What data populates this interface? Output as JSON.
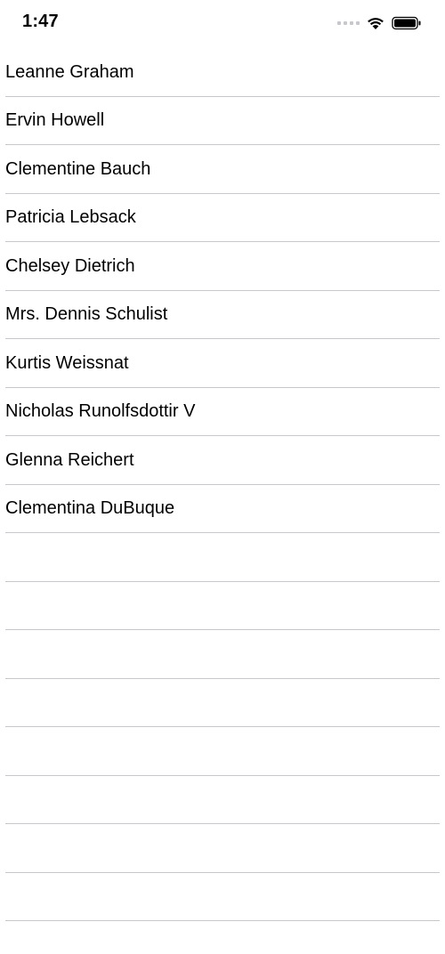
{
  "status_bar": {
    "time": "1:47",
    "icons": [
      "cellular-signal-icon",
      "wifi-icon",
      "battery-icon"
    ]
  },
  "users": [
    {
      "name": "Leanne Graham"
    },
    {
      "name": "Ervin Howell"
    },
    {
      "name": "Clementine Bauch"
    },
    {
      "name": "Patricia Lebsack"
    },
    {
      "name": "Chelsey Dietrich"
    },
    {
      "name": "Mrs. Dennis Schulist"
    },
    {
      "name": "Kurtis Weissnat"
    },
    {
      "name": "Nicholas Runolfsdottir V"
    },
    {
      "name": "Glenna Reichert"
    },
    {
      "name": "Clementina DuBuque"
    }
  ],
  "colors": {
    "background": "#ffffff",
    "text": "#000000",
    "separator": "#c8c7cc",
    "signal_inactive": "#c7c7cc"
  }
}
